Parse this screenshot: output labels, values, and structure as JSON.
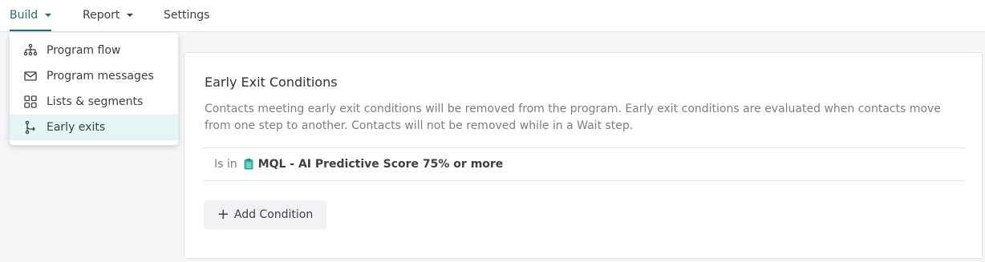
{
  "nav": {
    "tabs": [
      {
        "label": "Build",
        "active": true,
        "has_caret": true
      },
      {
        "label": "Report",
        "active": false,
        "has_caret": true
      },
      {
        "label": "Settings",
        "active": false,
        "has_caret": false
      }
    ]
  },
  "build_menu": {
    "items": [
      {
        "label": "Program flow",
        "icon": "sitemap-icon"
      },
      {
        "label": "Program messages",
        "icon": "envelope-icon"
      },
      {
        "label": "Lists & segments",
        "icon": "grid-icon"
      },
      {
        "label": "Early exits",
        "icon": "branch-exit-icon",
        "selected": true
      }
    ]
  },
  "card": {
    "title": "Early Exit Conditions",
    "description": "Contacts meeting early exit conditions will be removed from the program. Early exit conditions are evaluated when contacts move from one step to another. Contacts will not be removed while in a Wait step.",
    "condition": {
      "operator": "Is in",
      "list_name": "MQL - AI Predictive Score 75% or more",
      "list_icon": "list-icon"
    },
    "add_button_label": "Add Condition"
  },
  "colors": {
    "accent": "#1a6e7e",
    "selected_bg": "#e3f5f4",
    "list_icon": "#29b6a8"
  }
}
